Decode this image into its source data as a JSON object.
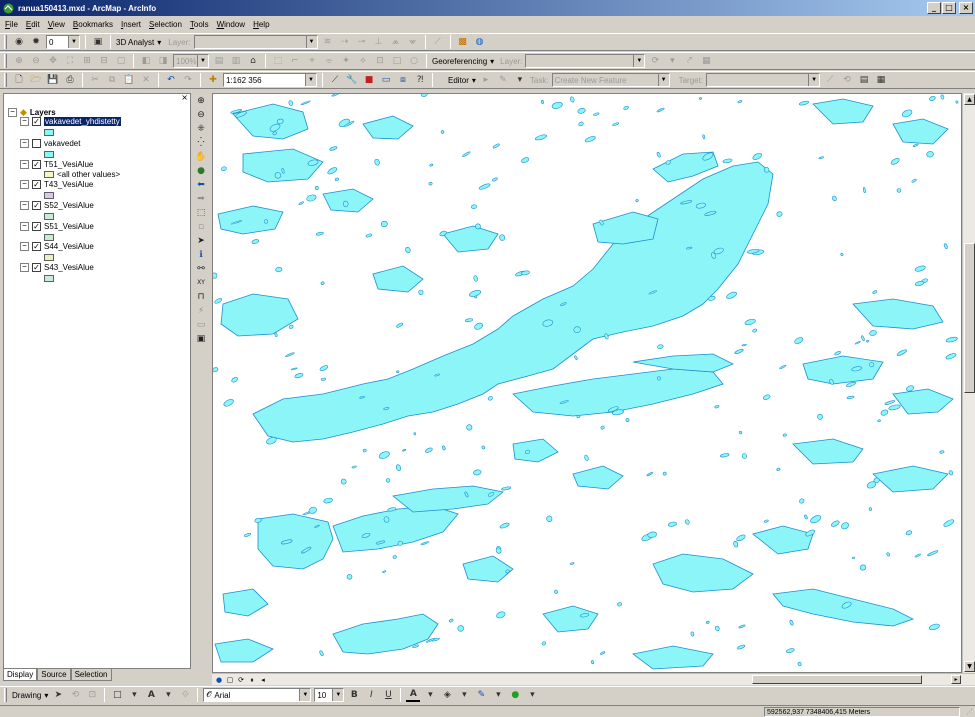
{
  "window": {
    "title": "ranua150413.mxd - ArcMap - ArcInfo",
    "minimize": "_",
    "maximize": "□",
    "close": "×"
  },
  "menu": [
    "File",
    "Edit",
    "View",
    "Bookmarks",
    "Insert",
    "Selection",
    "Tools",
    "Window",
    "Help"
  ],
  "toolbar1": {
    "zoom_value": "0",
    "analyst_label": "3D Analyst",
    "layer_label": "Layer:"
  },
  "toolbar2": {
    "zoom_percent": "100%",
    "georeferencing_label": "Georeferencing",
    "layer_label": "Layer:"
  },
  "toolbar3": {
    "scale_value": "1:162 356",
    "editor_label": "Editor",
    "task_label": "Task:",
    "task_value": "Create New Feature",
    "target_label": "Target:"
  },
  "toc": {
    "root_label": "Layers",
    "layers": [
      {
        "name": "vakavedet_yhdistetty",
        "checked": "✓",
        "swatch": "#8cf5f8"
      },
      {
        "name": "vakavedet",
        "checked": "",
        "swatch": "#8cf5f8"
      },
      {
        "name": "T51_VesiAlue",
        "checked": "✓",
        "swatch": "#f6f6c0",
        "sublabel": "<all other values>"
      },
      {
        "name": "T43_VesiAlue",
        "checked": "✓",
        "swatch": "#d8c8ec"
      },
      {
        "name": "S52_VesiAlue",
        "checked": "✓",
        "swatch": "#c8ecd8"
      },
      {
        "name": "S51_VesiAlue",
        "checked": "✓",
        "swatch": "#c8ecd0"
      },
      {
        "name": "S44_VesiAlue",
        "checked": "✓",
        "swatch": "#e4f2c4"
      },
      {
        "name": "S43_VesiAlue",
        "checked": "✓",
        "swatch": "#c8ece0"
      }
    ],
    "tabs": [
      "Display",
      "Source",
      "Selection"
    ]
  },
  "drawing": {
    "label": "Drawing",
    "font_value": "Arial",
    "size_value": "10",
    "bold": "B",
    "italic": "I",
    "underline": "U"
  },
  "status": {
    "coords": "592562,937  7348406,415 Meters"
  },
  "colors": {
    "water_fill": "#8cf5f8",
    "water_stroke": "#1a8fd0",
    "title_start": "#0a246a",
    "title_end": "#a6caf0"
  }
}
